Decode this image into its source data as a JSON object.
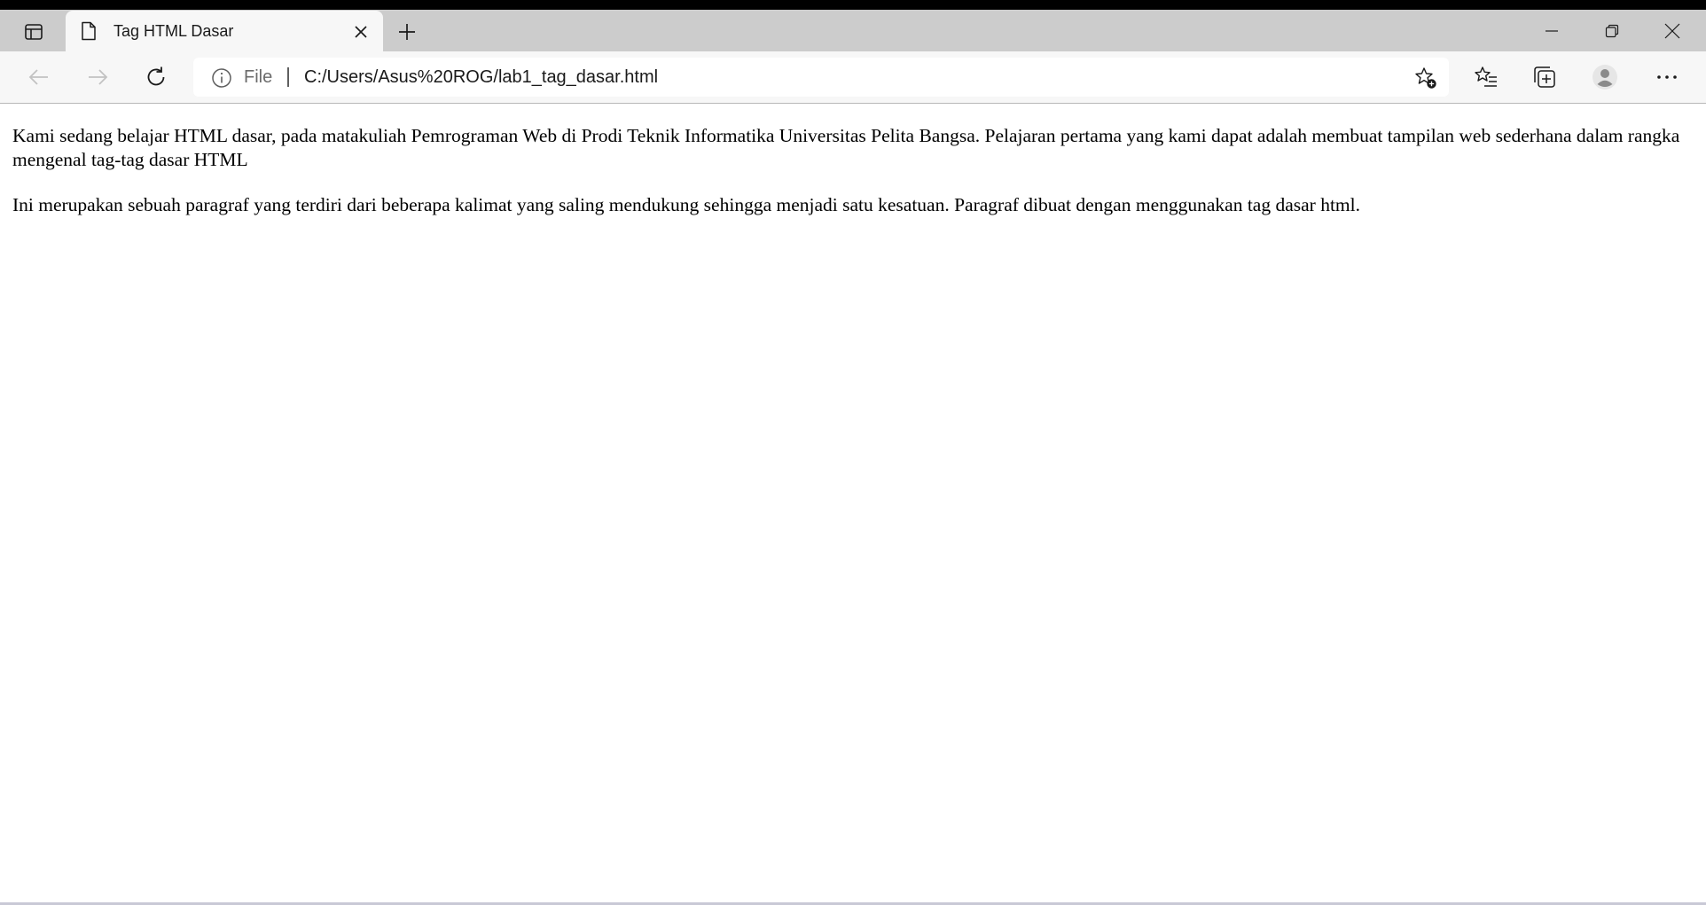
{
  "tab": {
    "title": "Tag HTML Dasar"
  },
  "address": {
    "scheme_label": "File",
    "url": "C:/Users/Asus%20ROG/lab1_tag_dasar.html"
  },
  "content": {
    "paragraphs": [
      "Kami sedang belajar HTML dasar, pada matakuliah Pemrograman Web di Prodi Teknik Informatika Universitas Pelita Bangsa. Pelajaran pertama yang kami dapat adalah membuat tampilan web sederhana dalam rangka mengenal tag-tag dasar HTML",
      "Ini merupakan sebuah paragraf yang terdiri dari beberapa kalimat yang saling mendukung sehingga menjadi satu kesatuan. Paragraf dibuat dengan menggunakan tag dasar html."
    ]
  },
  "icons": {
    "tab_actions": "tab-actions-icon",
    "page": "page-icon",
    "close_tab": "close-icon",
    "new_tab": "plus-icon",
    "minimize": "minimize-icon",
    "restore": "restore-icon",
    "close_window": "close-icon",
    "back": "arrow-left-icon",
    "forward": "arrow-right-icon",
    "reload": "refresh-icon",
    "info": "info-icon",
    "add_favorite": "star-plus-icon",
    "favorites": "favorites-icon",
    "collections": "collections-icon",
    "profile": "person-icon",
    "more": "more-icon"
  },
  "colors": {
    "tabbar_bg": "#cccccc",
    "active_tab_bg": "#f7f7f7",
    "toolbar_bg": "#f7f7f7",
    "page_bg": "#ffffff",
    "text": "#000000"
  }
}
